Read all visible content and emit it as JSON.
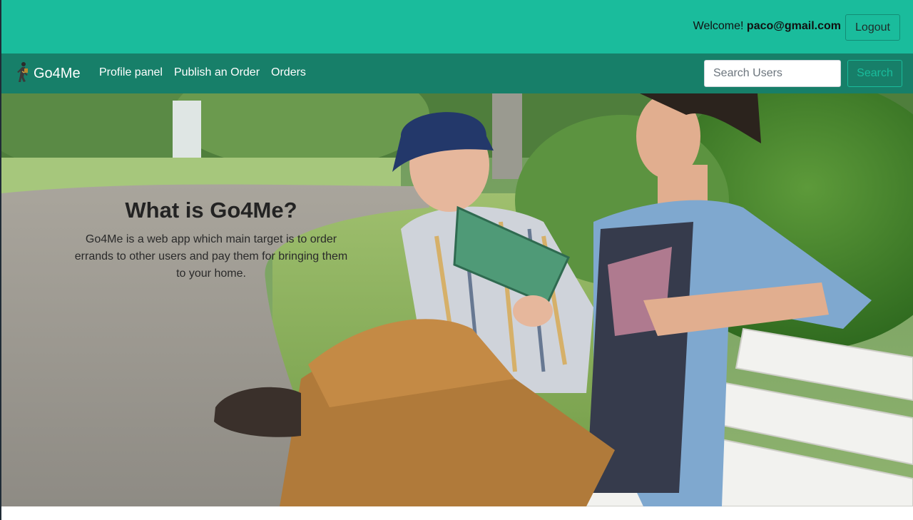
{
  "topbar": {
    "welcome_prefix": "Welcome!",
    "user_email": "paco@gmail.com",
    "logout_label": "Logout",
    "color": "#1abc9c"
  },
  "navbar": {
    "brand": "Go4Me",
    "brand_icon": "walking-figure-icon",
    "links": [
      "Profile panel",
      "Publish an Order",
      "Orders"
    ],
    "search": {
      "placeholder": "Search Users",
      "value": "",
      "button_label": "Search"
    },
    "color": "#177f69"
  },
  "hero": {
    "title": "What is Go4Me?",
    "description": "Go4Me is a web app which main target is to order errands to other users and pay them for bringing them to your home."
  }
}
